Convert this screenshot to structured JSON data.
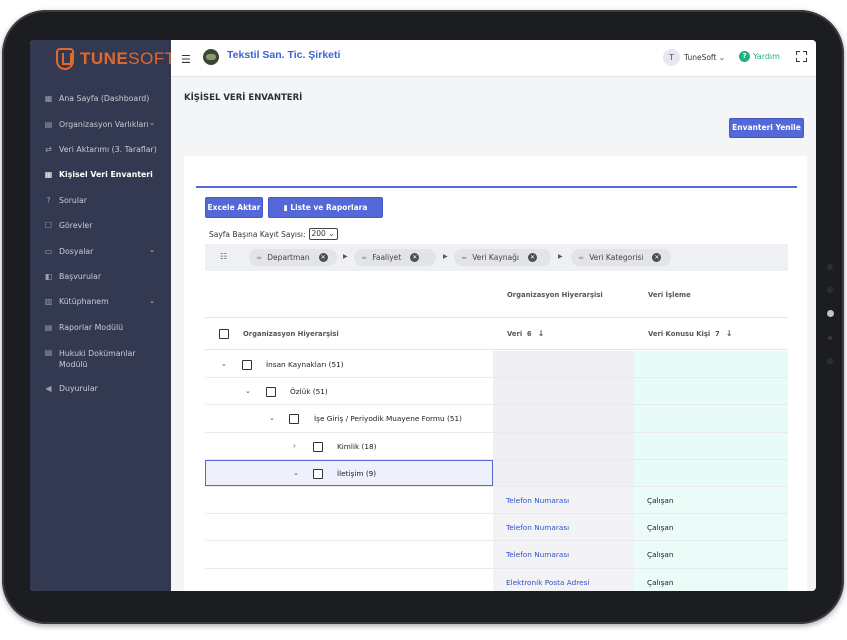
{
  "brand": {
    "part1": "TUNE",
    "part2": "SOFT"
  },
  "sidebar": {
    "items": [
      {
        "label": "Ana Sayfa (Dashboard)",
        "icon": "dashboard-icon"
      },
      {
        "label": "Organizasyon Varlıkları",
        "icon": "clipboard-icon",
        "chevron": "⌄"
      },
      {
        "label": "Veri Aktarımı (3. Taraflar)",
        "icon": "transfer-icon"
      },
      {
        "label": "Kişisel Veri Envanteri",
        "icon": "table-icon"
      },
      {
        "label": "Sorular",
        "icon": "question-icon"
      },
      {
        "label": "Görevler",
        "icon": "tasks-icon"
      },
      {
        "label": "Dosyalar",
        "icon": "folder-icon",
        "chevron": "⌄"
      },
      {
        "label": "Başvurular",
        "icon": "applications-icon"
      },
      {
        "label": "Kütüphanem",
        "icon": "library-icon",
        "chevron": "⌄"
      },
      {
        "label": "Raporlar Modülü",
        "icon": "reports-icon"
      },
      {
        "label": "Hukuki Dokümanlar Modülü",
        "icon": "legal-docs-icon"
      },
      {
        "label": "Duyurular",
        "icon": "megaphone-icon"
      }
    ]
  },
  "header": {
    "company": "Tekstil San. Tic. Şirketi",
    "user_initial": "T",
    "user_name": "TuneSoft",
    "help": "Yardım"
  },
  "page": {
    "title": "KİŞİSEL VERİ ENVANTERİ",
    "renew_button": "Envanteri Yenile",
    "excel_button": "Excele Aktar",
    "save_button": "Liste ve Raporlara Kaydet",
    "page_size_label": "Sayfa Başına Kayıt Sayısı:",
    "page_size_value": "200",
    "group_chips": [
      "Departman",
      "Faaliyet",
      "Veri Kaynağı",
      "Veri Kategorisi"
    ]
  },
  "table": {
    "top_headers": [
      "Organizasyon Hiyerarşisi",
      "Veri İşleme"
    ],
    "col_headers": {
      "hierarchy": "Organizasyon Hiyerarşisi",
      "veri": "Veri",
      "veri_count": "6",
      "kisi": "Veri Konusu Kişi",
      "kisi_count": "7"
    },
    "tree": [
      {
        "label": "İnsan Kaynakları (51)"
      },
      {
        "label": "Özlük (51)"
      },
      {
        "label": "İşe Giriş / Periyodik Muayene Formu (51)"
      },
      {
        "label": "Kimlik (18)"
      },
      {
        "label": "İletişim (9)"
      }
    ],
    "leaf_rows": [
      {
        "veri": "Telefon Numarası",
        "kisi": "Çalışan"
      },
      {
        "veri": "Telefon Numarası",
        "kisi": "Çalışan"
      },
      {
        "veri": "Telefon Numarası",
        "kisi": "Çalışan"
      },
      {
        "veri": "Elektronik Posta Adresi",
        "kisi": "Çalışan"
      }
    ]
  },
  "colors": {
    "sidebar_bg": "#333950",
    "accent": "#5468d8",
    "brand_orange": "#e1692b",
    "help_green": "#22b07d"
  }
}
